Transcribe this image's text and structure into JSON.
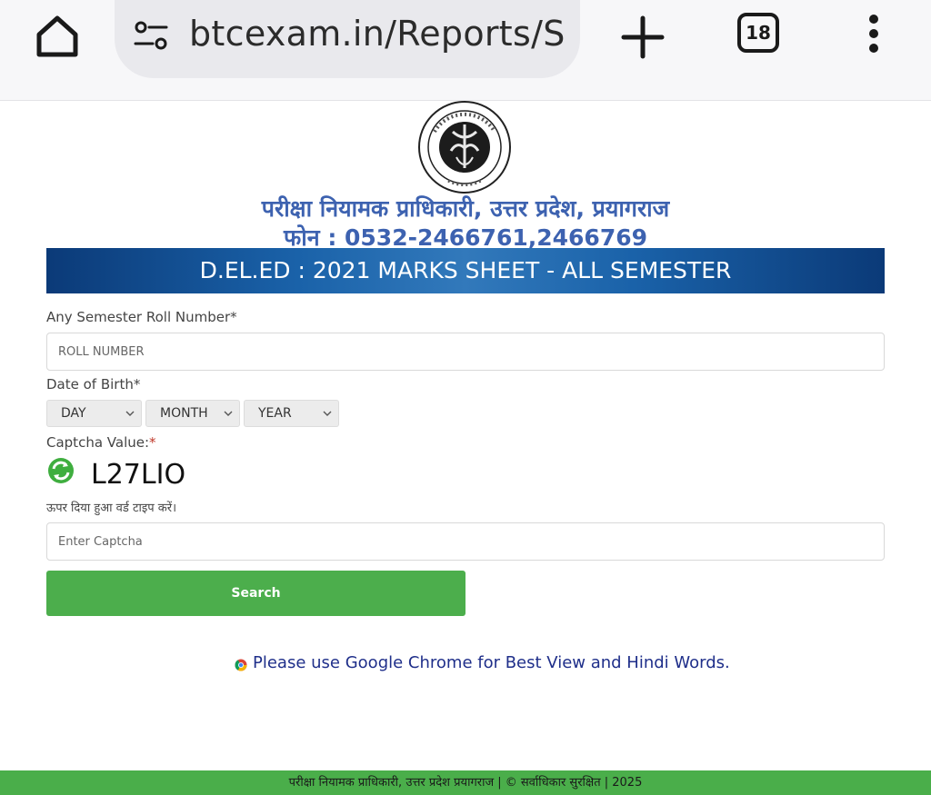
{
  "browser": {
    "url": "btcexam.in/Reports/S",
    "tab_count": "18"
  },
  "header": {
    "org_name": "परीक्षा नियामक प्राधिकारी, उत्तर प्रदेश, प्रयागराज",
    "phone": "फोन : 0532-2466761,2466769",
    "banner_title": "D.EL.ED : 2021 MARKS SHEET - ALL SEMESTER"
  },
  "form": {
    "roll_label": "Any Semester Roll Number*",
    "roll_placeholder": "ROLL NUMBER",
    "dob_label": "Date of Birth*",
    "day_select": "DAY",
    "month_select": "MONTH",
    "year_select": "YEAR",
    "captcha_label": "Captcha Value:",
    "captcha_required_mark": "*",
    "captcha_value": "L27LIO",
    "captcha_hint": "ऊपर दिया हुआ वर्ड टाइप करें।",
    "captcha_placeholder": "Enter Captcha",
    "search_label": "Search"
  },
  "notice": {
    "text": "Please use Google Chrome for Best View and Hindi Words."
  },
  "footer": {
    "text": "परीक्षा नियामक प्राधिकारी, उत्तर प्रदेश प्रयागराज | © सर्वाधिकार सुरक्षित | 2025"
  },
  "icons": {
    "home": "home-icon",
    "site_settings": "site-settings-icon",
    "new_tab": "plus-icon",
    "menu": "more-vert-icon",
    "refresh": "refresh-icon",
    "chrome": "chrome-icon",
    "emblem": "up-emblem-logo"
  },
  "colors": {
    "title_blue": "#3d62b0",
    "banner_blue": "#1a62a9",
    "button_green": "#4cae4c",
    "footer_green": "#4aae4a"
  }
}
